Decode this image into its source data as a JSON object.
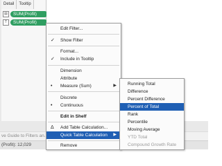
{
  "marks_card": {
    "tabs": [
      "Detail",
      "Tooltip"
    ],
    "pills": [
      {
        "label": "SUM(Profit)",
        "icon": "tooltip-icon"
      },
      {
        "label": "SUM(Profit)",
        "icon": "T"
      }
    ]
  },
  "tip_bar": {
    "text": "ve Guide to Filters an..."
  },
  "status_bar": {
    "text": "(Profit): 12,029"
  },
  "context_menu": {
    "items": [
      {
        "label": "Edit Filter...",
        "check": "",
        "arrow": false
      },
      {
        "label": "Show Filter",
        "check": "✓",
        "arrow": false
      },
      {
        "label": "Format...",
        "check": "",
        "arrow": false
      },
      {
        "label": "Include in Tooltip",
        "check": "✓",
        "arrow": false
      },
      {
        "label": "Dimension",
        "check": "",
        "arrow": false
      },
      {
        "label": "Attribute",
        "check": "",
        "arrow": false
      },
      {
        "label": "Measure (Sum)",
        "check": "•",
        "arrow": true
      },
      {
        "label": "Discrete",
        "check": "",
        "arrow": false
      },
      {
        "label": "Continuous",
        "check": "•",
        "arrow": false
      },
      {
        "label": "Edit in Shelf",
        "check": "",
        "arrow": false,
        "bold": true
      },
      {
        "label": "Add Table Calculation...",
        "check": "Δ",
        "arrow": false
      },
      {
        "label": "Quick Table Calculation",
        "check": "",
        "arrow": true,
        "highlight": true
      },
      {
        "label": "Remove",
        "check": "",
        "arrow": false
      }
    ]
  },
  "quick_table_calc_submenu": {
    "items": [
      {
        "label": "Running Total"
      },
      {
        "label": "Difference"
      },
      {
        "label": "Percent Difference"
      },
      {
        "label": "Percent of Total",
        "highlight": true
      },
      {
        "label": "Rank"
      },
      {
        "label": "Percentile"
      },
      {
        "label": "Moving Average"
      },
      {
        "label": "YTD Total",
        "disabled": true
      },
      {
        "label": "Compound Growth Rate",
        "disabled": true
      }
    ]
  },
  "colors": {
    "pill_green": "#2f9e61",
    "menu_highlight": "#1f5fb4",
    "disabled_text": "#9a9a9a"
  }
}
